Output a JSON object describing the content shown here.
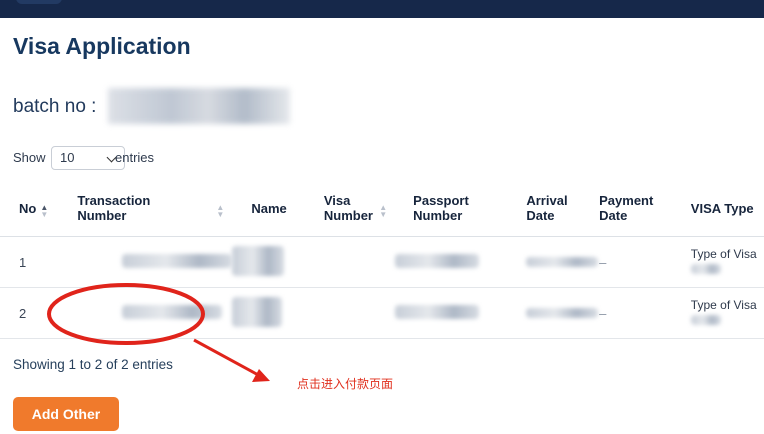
{
  "page": {
    "title": "Visa Application"
  },
  "batch": {
    "label": "batch no :"
  },
  "length": {
    "prefix": "Show",
    "value": "10",
    "suffix": "entries"
  },
  "table": {
    "headers": {
      "no": "No",
      "transaction_line1": "Transaction",
      "transaction_line2": "Number",
      "name": "Name",
      "visa_line1": "Visa",
      "visa_line2": "Number",
      "passport_line1": "Passport",
      "passport_line2": "Number",
      "arrival_line1": "Arrival",
      "arrival_line2": "Date",
      "payment_line1": "Payment",
      "payment_line2": "Date",
      "visa_type": "VISA Type"
    },
    "rows": [
      {
        "no": "1",
        "payment_date": "–",
        "visa_type": "Type of Visa"
      },
      {
        "no": "2",
        "payment_date": "–",
        "visa_type": "Type of Visa"
      }
    ]
  },
  "footer": {
    "info": "Showing 1 to 2 of 2 entries"
  },
  "annotation": {
    "text": "点击进入付款页面",
    "color": "#e0301e"
  },
  "buttons": {
    "add_other": "Add Other"
  },
  "colors": {
    "topbar": "#16284a",
    "accent": "#f07a2c",
    "title": "#17385f"
  }
}
